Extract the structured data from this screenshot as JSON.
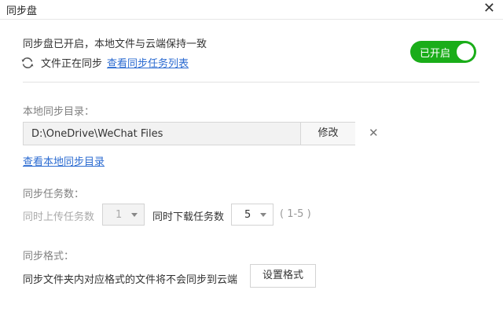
{
  "window": {
    "title": "同步盘",
    "close_symbol": "✕"
  },
  "status": {
    "message": "同步盘已开启，本地文件与云端保持一致",
    "syncing_text": "文件正在同步",
    "view_tasks_link": "查看同步任务列表",
    "toggle_label": "已开启",
    "toggle_on": true,
    "toggle_color": "#1aad19"
  },
  "local_dir": {
    "label": "本地同步目录：",
    "path": "D:\\OneDrive\\WeChat Files",
    "modify_button": "修改",
    "clear_symbol": "✕",
    "view_link": "查看本地同步目录"
  },
  "tasks": {
    "label": "同步任务数：",
    "upload_label": "同时上传任务数",
    "upload_value": "1",
    "download_label": "同时下载任务数",
    "download_value": "5",
    "range_hint": "( 1-5 )"
  },
  "format": {
    "label": "同步格式：",
    "description": "同步文件夹内对应格式的文件将不会同步到云端",
    "button": "设置格式"
  },
  "icons": {
    "sync": "sync-icon",
    "close": "close-icon",
    "clear": "clear-icon",
    "dropdown": "chevron-down-icon"
  },
  "colors": {
    "link": "#2b6bd1",
    "accent_green": "#1aad19"
  }
}
